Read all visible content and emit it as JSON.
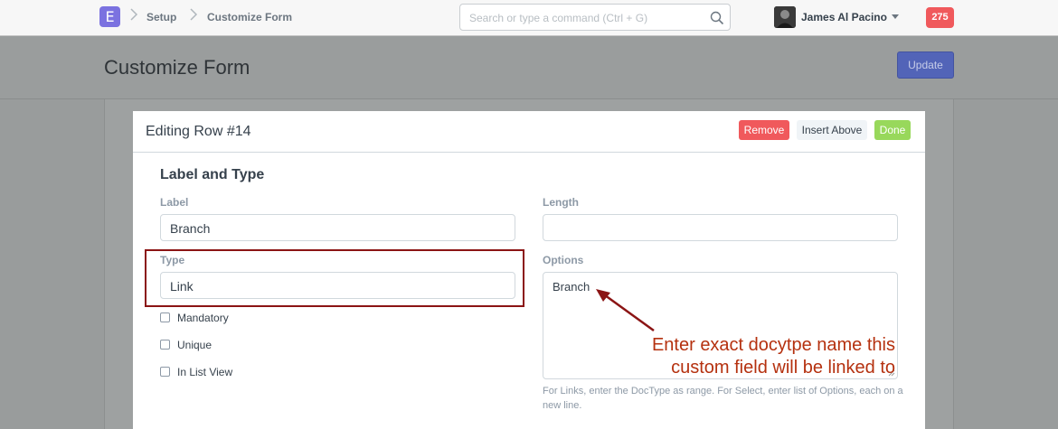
{
  "navbar": {
    "logo_letter": "E",
    "breadcrumbs": [
      "Setup",
      "Customize Form"
    ],
    "search_placeholder": "Search or type a command (Ctrl + G)",
    "user_name": "James Al Pacino",
    "notification_count": "275"
  },
  "page": {
    "title": "Customize Form",
    "update_label": "Update"
  },
  "dialog": {
    "title": "Editing Row #14",
    "remove_label": "Remove",
    "insert_above_label": "Insert Above",
    "done_label": "Done",
    "section_title": "Label and Type",
    "fields": {
      "label": {
        "label": "Label",
        "value": "Branch"
      },
      "type": {
        "label": "Type",
        "value": "Link"
      },
      "length": {
        "label": "Length",
        "value": ""
      },
      "options": {
        "label": "Options",
        "value": "Branch"
      }
    },
    "checkboxes": [
      {
        "label": "Mandatory",
        "checked": false
      },
      {
        "label": "Unique",
        "checked": false
      },
      {
        "label": "In List View",
        "checked": false
      }
    ],
    "options_help": "For Links, enter the DocType as range. For Select, enter list of Options, each on a new line."
  },
  "annotation": {
    "text_line1": "Enter exact docytpe name this",
    "text_line2": "custom field will be linked to",
    "color": "#b5310f",
    "highlight_color": "#8b1414"
  },
  "colors": {
    "accent": "#7b72e0",
    "primary_button": "#5264b8",
    "danger": "#f0595c",
    "success": "#98d85b"
  }
}
